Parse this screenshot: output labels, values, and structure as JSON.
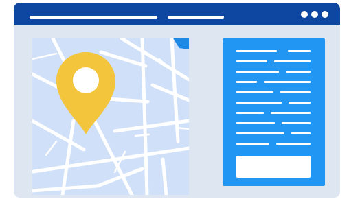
{
  "colors": {
    "window_background": "#dde6f1",
    "titlebar": "#0d47a1",
    "map_background": "#cfe0f8",
    "map_roads": "#ffffff",
    "map_accent": "#1e88e5",
    "pin": "#f2c53d",
    "panel": "#2196f3",
    "panel_content": "#ffffff"
  },
  "icons": {
    "window_menu": "three-dots-icon",
    "location": "map-pin-icon"
  }
}
